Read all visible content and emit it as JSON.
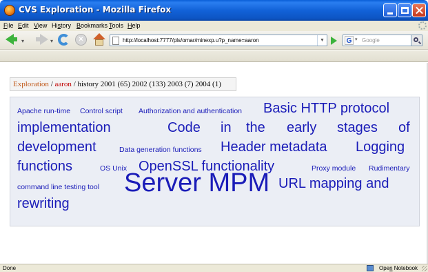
{
  "window": {
    "title": "CVS Exploration - Mozilla Firefox"
  },
  "menu": {
    "file": {
      "u": "F",
      "rest": "ile"
    },
    "edit": {
      "u": "E",
      "rest": "dit"
    },
    "view": {
      "u": "V",
      "rest": "iew"
    },
    "history": {
      "pre": "Hi",
      "u": "s",
      "rest": "tory"
    },
    "bookmarks": {
      "u": "B",
      "rest": "ookmarks"
    },
    "tools": {
      "u": "T",
      "rest": "ools"
    },
    "help": {
      "u": "H",
      "rest": "elp"
    }
  },
  "navbar": {
    "url": "http://localhost:7777/pls/omar/minexp.u?p_name=aaron",
    "search_placeholder": "Google"
  },
  "breadcrumb": {
    "root": "Exploration",
    "sep1": " / ",
    "user": "aaron",
    "sep2": " / ",
    "rest": "history 2001 (65) 2002 (133) 2003 (7) 2004 (1)"
  },
  "tag_cloud": {
    "apache_runtime": "Apache run-time",
    "control_script": "Control script",
    "authorization": "Authorization and authentication",
    "basic_http": "Basic HTTP protocol",
    "implementation": "implementation",
    "code_w1": "Code",
    "code_w2": "in",
    "code_w3": "the",
    "code_w4": "early",
    "code_w5": "stages",
    "code_w6": "of",
    "development": "development",
    "data_generation": "Data generation functions",
    "header_metadata": "Header metadata",
    "logging": "Logging",
    "functions": "functions",
    "os_unix": "OS Unix",
    "openssl": "OpenSSL functionality",
    "proxy_module": "Proxy module",
    "rudimentary": "Rudimentary",
    "command_line": "command line testing tool",
    "server_mpm": "Server MPM",
    "url_mapping": "URL mapping and",
    "rewriting": "rewriting"
  },
  "status": {
    "text": "Done",
    "notebook_pre": "Ope",
    "notebook_u": "n",
    "notebook_rest": " Notebook"
  }
}
